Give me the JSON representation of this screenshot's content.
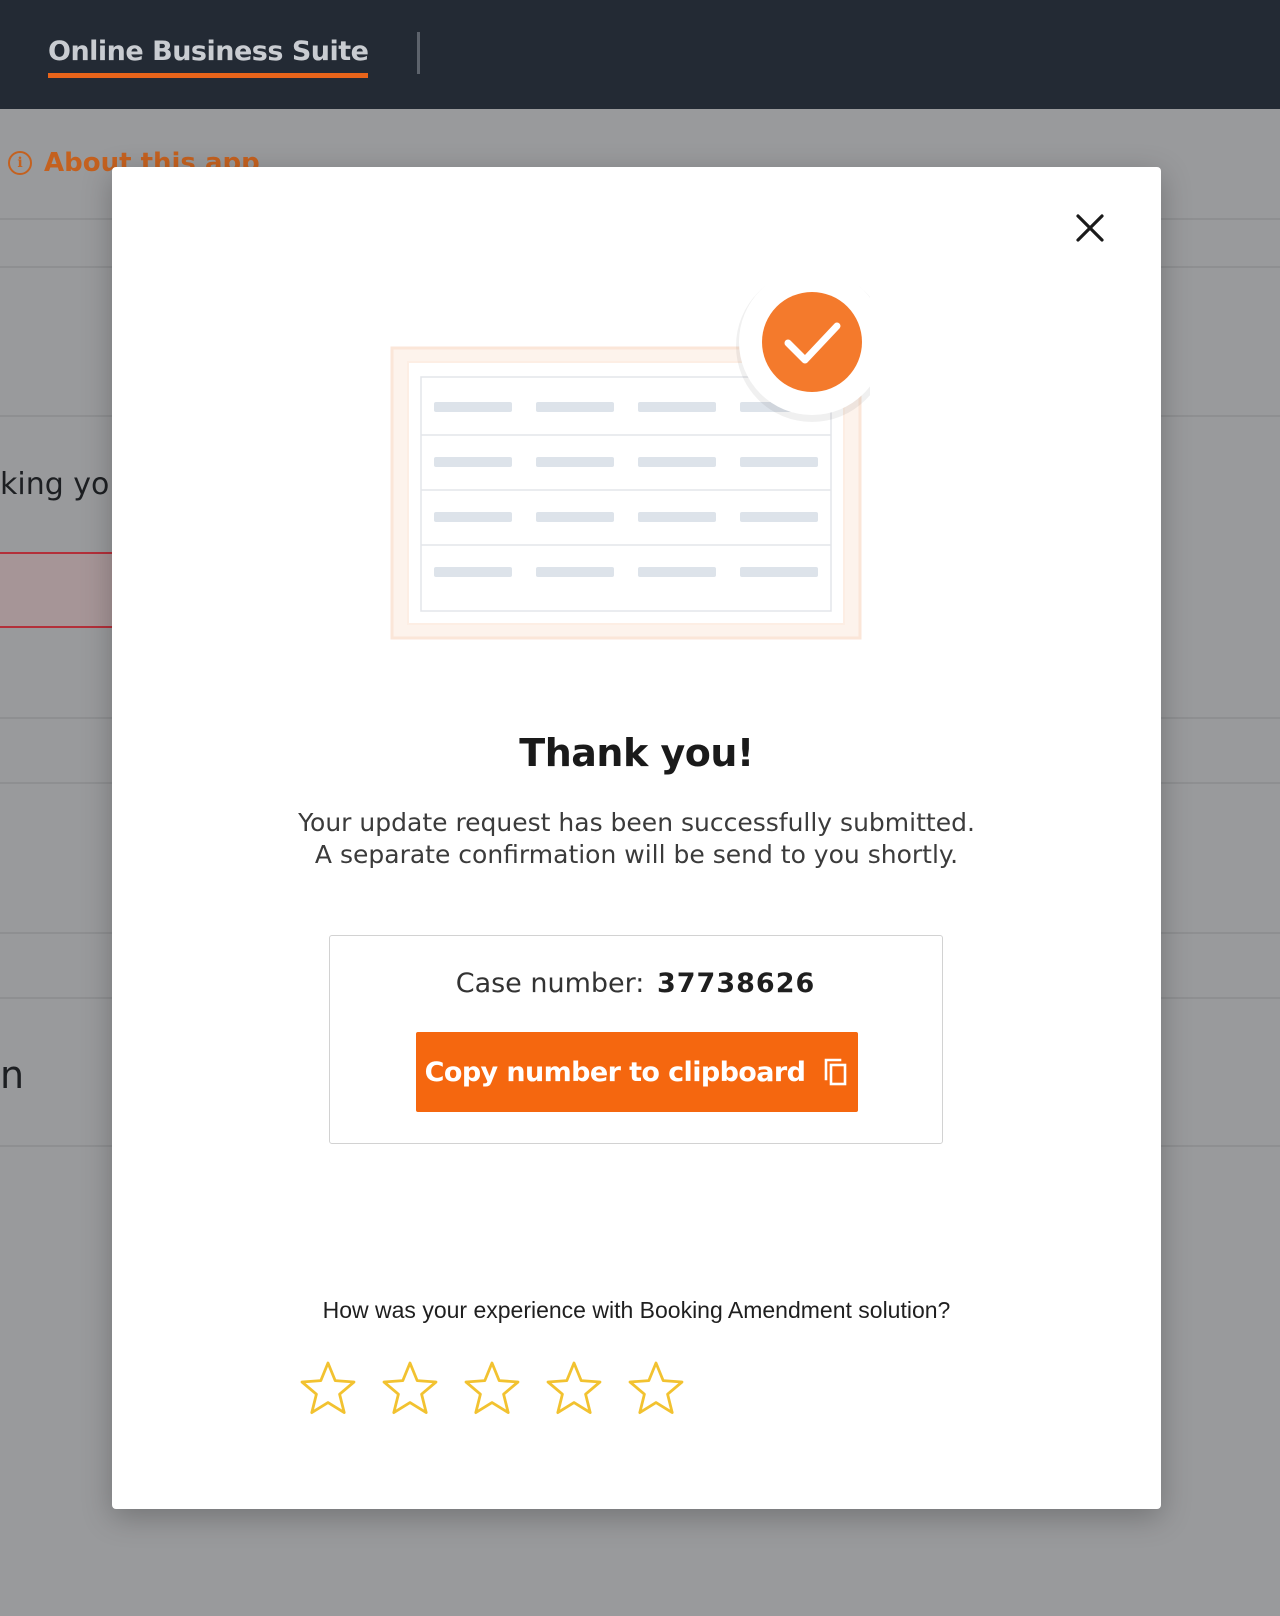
{
  "header": {
    "brand": "Online Business Suite"
  },
  "background": {
    "about_link": "About this app",
    "partial_text_1": "king yo",
    "partial_text_2": "n"
  },
  "modal": {
    "title": "Thank you!",
    "message_line1": "Your update request has been successfully submitted.",
    "message_line2": "A separate confirmation will be send to you shortly.",
    "case_label": "Case number:",
    "case_number": "37738626",
    "copy_button_label": "Copy number to clipboard",
    "rating_question": "How was your experience with Booking Amendment solution?",
    "rating": {
      "selected": 0,
      "max": 5
    },
    "icons": {
      "close": "close-icon",
      "success": "checkmark-icon",
      "copy": "copy-icon",
      "star": "star-outline-icon"
    }
  },
  "colors": {
    "accent": "#f5670f",
    "success_circle": "#f47a2c",
    "star": "#f2c230",
    "topbar": "#232a34",
    "overlay": "#999a9c"
  }
}
